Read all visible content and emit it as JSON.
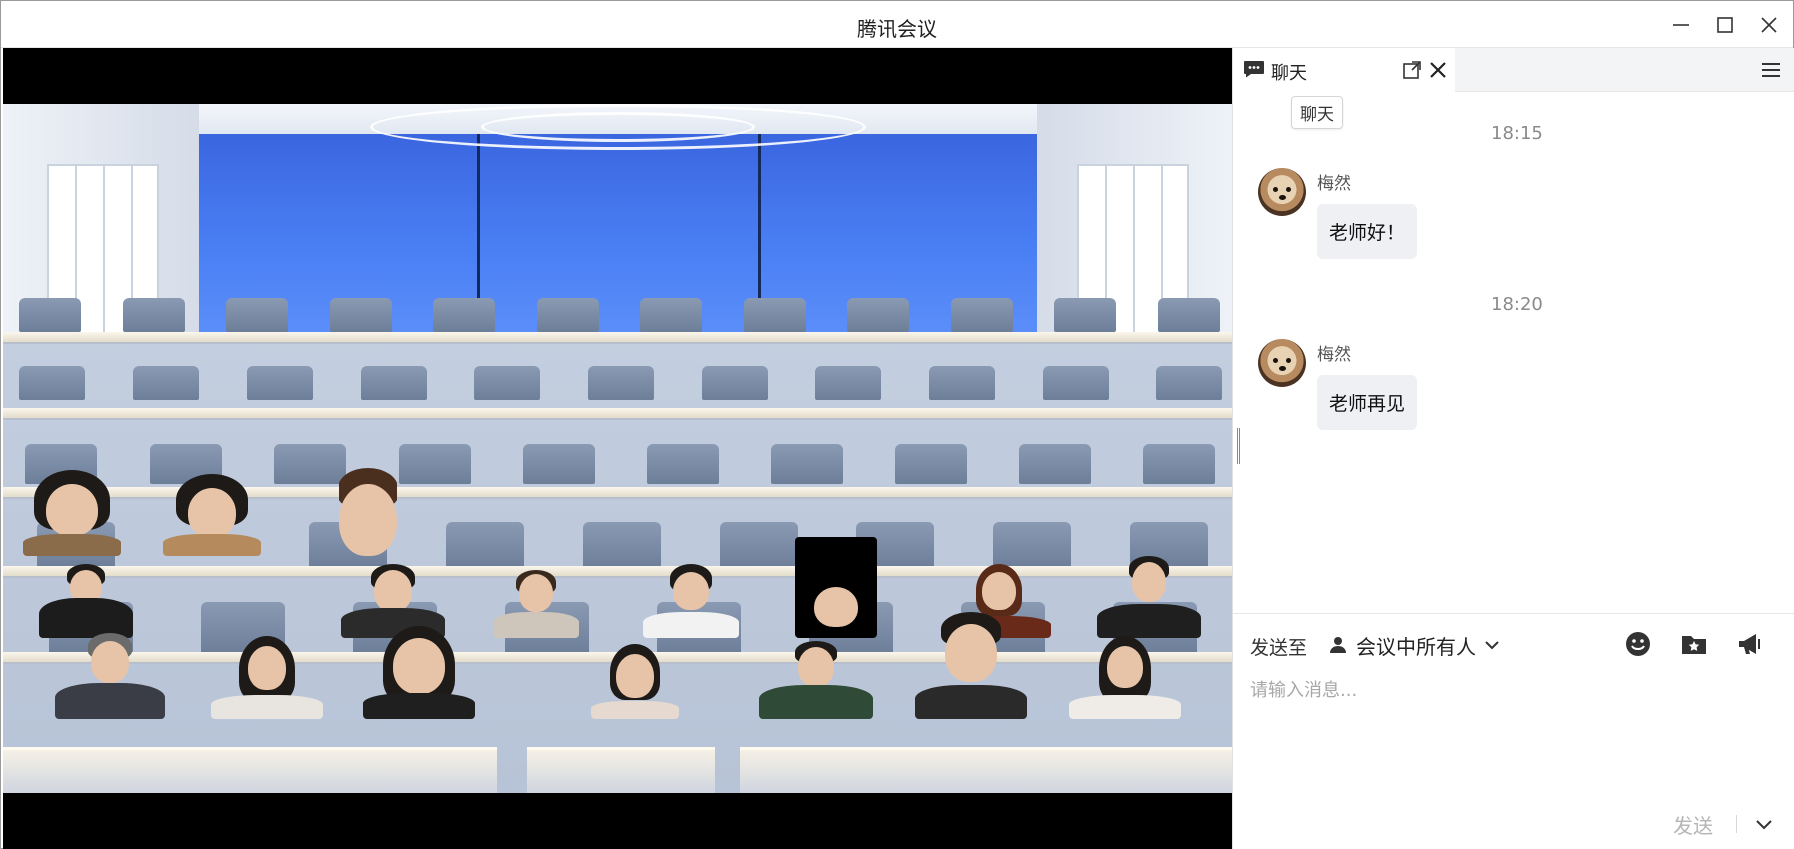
{
  "window": {
    "title": "腾讯会议"
  },
  "chat": {
    "tab_label": "聊天",
    "section_tag": "聊天",
    "messages": [
      {
        "time": "18:15",
        "sender": "梅然",
        "text": "老师好！"
      },
      {
        "time": "18:20",
        "sender": "梅然",
        "text": "老师再见"
      }
    ],
    "compose": {
      "send_to_label": "发送至",
      "recipient": "会议中所有人",
      "placeholder": "请输入消息...",
      "send_label": "发送"
    }
  },
  "icons": {
    "chat_tab": "chat-bubble-icon",
    "popout": "popout-icon",
    "close": "close-icon",
    "menu": "hamburger-menu-icon",
    "recipient": "person-icon",
    "dropdown": "chevron-down-icon",
    "emoji": "emoji-icon",
    "file": "folder-star-icon",
    "announce": "megaphone-icon"
  },
  "colors": {
    "backwall": "#4b80f5",
    "bubble": "#eef0f4",
    "timestamp": "#8a8a8a",
    "send_disabled": "#b5b5b5"
  }
}
